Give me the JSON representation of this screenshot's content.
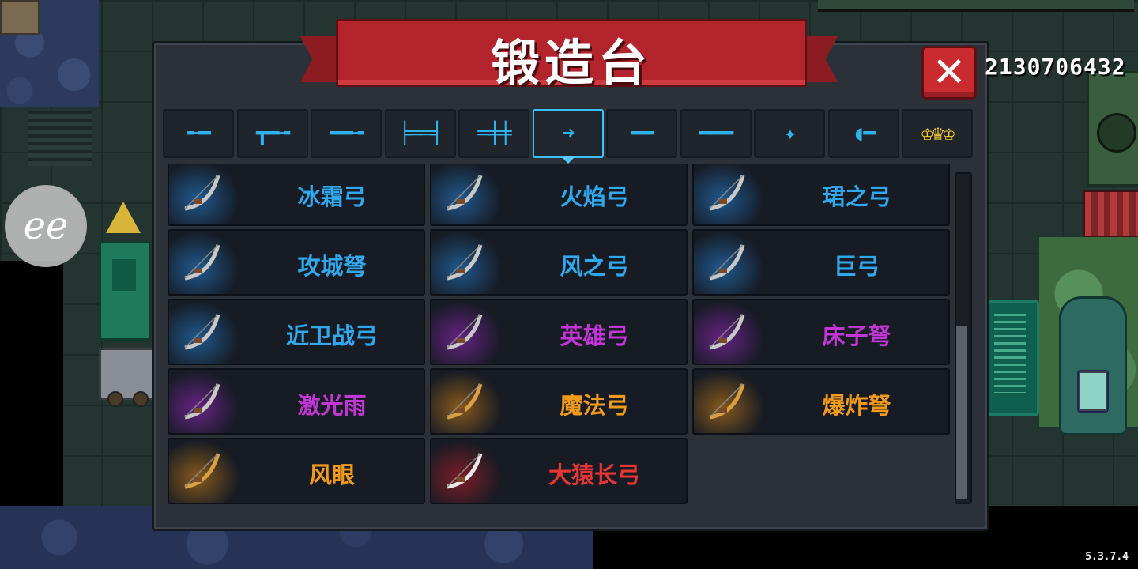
{
  "title": "锻造台",
  "currency_value": "2130706432",
  "version": "5.3.7.4",
  "overlay_badge": "ee",
  "colors": {
    "blue_text": "#2fa8ee",
    "purple_text": "#c236d6",
    "orange_text": "#f29a1c",
    "red_text": "#e53535",
    "banner_red": "#b3242c",
    "tab_active": "#3fc1ff"
  },
  "tabs": [
    {
      "icon": "pistol-icon",
      "glyph": "╾━",
      "active": false
    },
    {
      "icon": "rifle-icon",
      "glyph": "┳━╼",
      "active": false
    },
    {
      "icon": "shotgun-icon",
      "glyph": "━━╼",
      "active": false
    },
    {
      "icon": "launcher-icon",
      "glyph": "╞══╡",
      "active": false
    },
    {
      "icon": "laser-gun-icon",
      "glyph": "═╪╪",
      "active": false
    },
    {
      "icon": "bow-icon",
      "glyph": "➜",
      "active": true
    },
    {
      "icon": "sword-icon",
      "glyph": "━━",
      "active": false
    },
    {
      "icon": "spear-icon",
      "glyph": "━━━",
      "active": false
    },
    {
      "icon": "throwing-star-icon",
      "glyph": "✦",
      "active": false
    },
    {
      "icon": "fish-icon",
      "glyph": "◖━",
      "active": false
    },
    {
      "icon": "crown-icon",
      "glyph": "♔♛♔",
      "active": false
    }
  ],
  "weapons": [
    {
      "name": "冰霜弓",
      "rarity": "blue",
      "icon": "frost-bow-icon"
    },
    {
      "name": "火焰弓",
      "rarity": "blue",
      "icon": "flame-bow-icon"
    },
    {
      "name": "珺之弓",
      "rarity": "blue",
      "icon": "jun-bow-icon"
    },
    {
      "name": "攻城弩",
      "rarity": "blue",
      "icon": "siege-crossbow-icon"
    },
    {
      "name": "风之弓",
      "rarity": "blue",
      "icon": "wind-bow-icon"
    },
    {
      "name": "巨弓",
      "rarity": "blue",
      "icon": "giant-bow-icon"
    },
    {
      "name": "近卫战弓",
      "rarity": "blue",
      "icon": "guard-bow-icon"
    },
    {
      "name": "英雄弓",
      "rarity": "purple",
      "icon": "hero-bow-icon"
    },
    {
      "name": "床子弩",
      "rarity": "purple",
      "icon": "bed-crossbow-icon"
    },
    {
      "name": "激光雨",
      "rarity": "purple",
      "icon": "laser-rain-icon"
    },
    {
      "name": "魔法弓",
      "rarity": "orange",
      "icon": "magic-bow-icon"
    },
    {
      "name": "爆炸弩",
      "rarity": "orange",
      "icon": "explosive-crossbow-icon"
    },
    {
      "name": "风眼",
      "rarity": "orange",
      "icon": "wind-eye-icon"
    },
    {
      "name": "大猿长弓",
      "rarity": "red",
      "icon": "ape-longbow-icon"
    }
  ]
}
